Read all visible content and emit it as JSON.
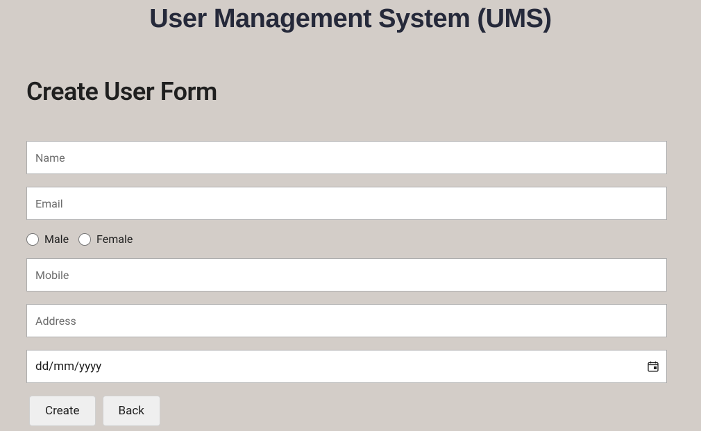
{
  "app": {
    "title": "User Management System (UMS)"
  },
  "form": {
    "heading": "Create User Form",
    "name": {
      "placeholder": "Name",
      "value": ""
    },
    "email": {
      "placeholder": "Email",
      "value": ""
    },
    "gender": {
      "options": {
        "male": "Male",
        "female": "Female"
      }
    },
    "mobile": {
      "placeholder": "Mobile",
      "value": ""
    },
    "address": {
      "placeholder": "Address",
      "value": ""
    },
    "date": {
      "placeholder": "dd/mm/yyyy",
      "value": "dd/mm/yyyy"
    },
    "buttons": {
      "create": "Create",
      "back": "Back"
    }
  }
}
